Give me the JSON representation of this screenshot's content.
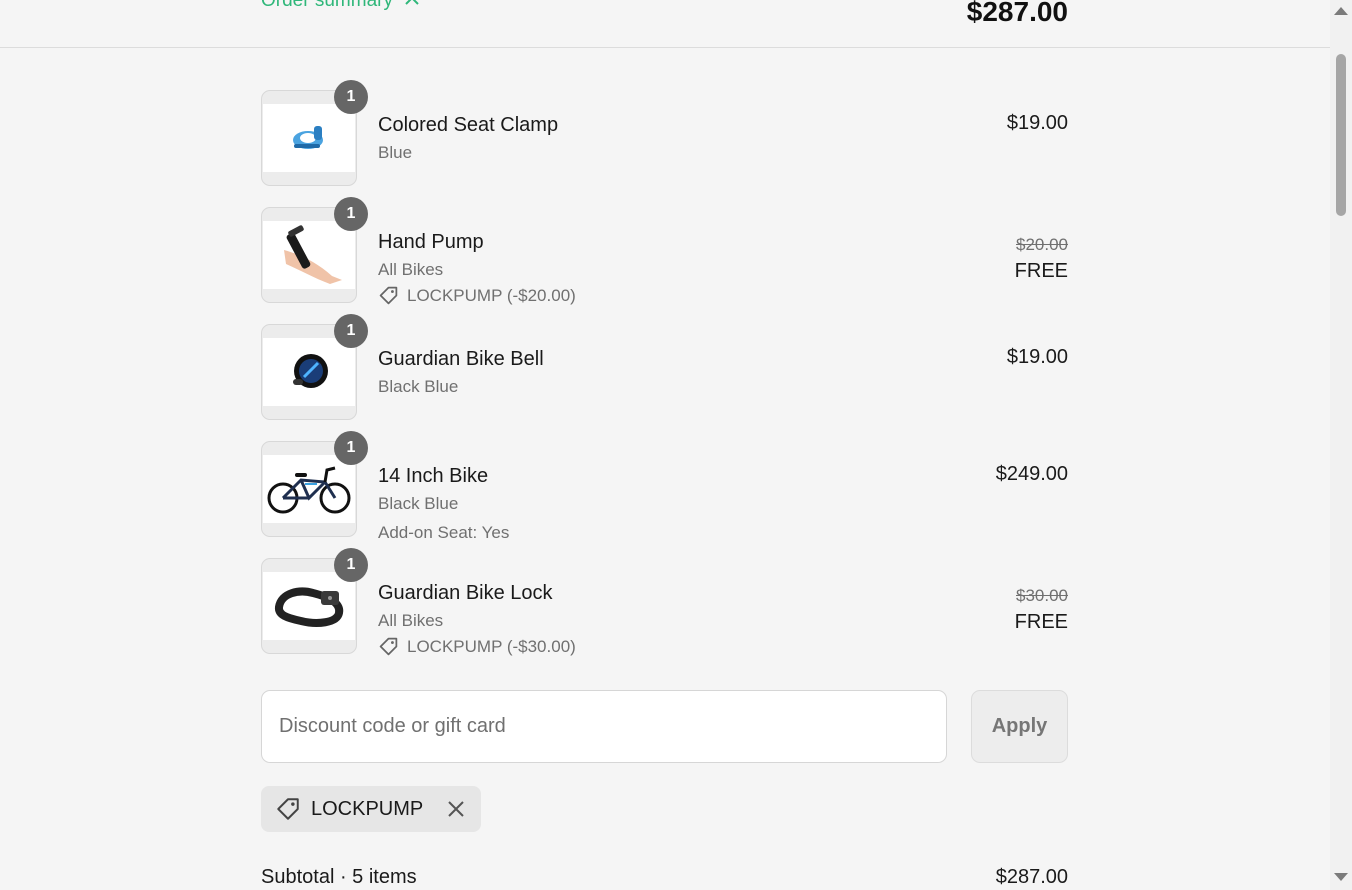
{
  "header": {
    "summary_toggle_label": "Order summary",
    "total": "$287.00"
  },
  "items": [
    {
      "quantity": "1",
      "name": "Colored Seat Clamp",
      "variant": "Blue",
      "price": "$19.00",
      "thumbnail_icon": "seat-clamp-image"
    },
    {
      "quantity": "1",
      "name": "Hand Pump",
      "variant": "All Bikes",
      "discount": "LOCKPUMP (-$20.00)",
      "original_price": "$20.00",
      "price": "FREE",
      "thumbnail_icon": "hand-pump-image"
    },
    {
      "quantity": "1",
      "name": "Guardian Bike Bell",
      "variant": "Black Blue",
      "price": "$19.00",
      "thumbnail_icon": "bike-bell-image"
    },
    {
      "quantity": "1",
      "name": "14 Inch Bike",
      "variant": "Black Blue",
      "extra": "Add-on Seat: Yes",
      "price": "$249.00",
      "thumbnail_icon": "bike-image"
    },
    {
      "quantity": "1",
      "name": "Guardian Bike Lock",
      "variant": "All Bikes",
      "discount": "LOCKPUMP (-$30.00)",
      "original_price": "$30.00",
      "price": "FREE",
      "thumbnail_icon": "bike-lock-image"
    }
  ],
  "discount_form": {
    "placeholder": "Discount code or gift card",
    "apply_label": "Apply"
  },
  "applied_code": "LOCKPUMP",
  "subtotal": {
    "label": "Subtotal · 5 items",
    "value": "$287.00"
  },
  "colors": {
    "accent": "#2fb77a",
    "badge": "#666666",
    "background": "#f5f5f5"
  }
}
